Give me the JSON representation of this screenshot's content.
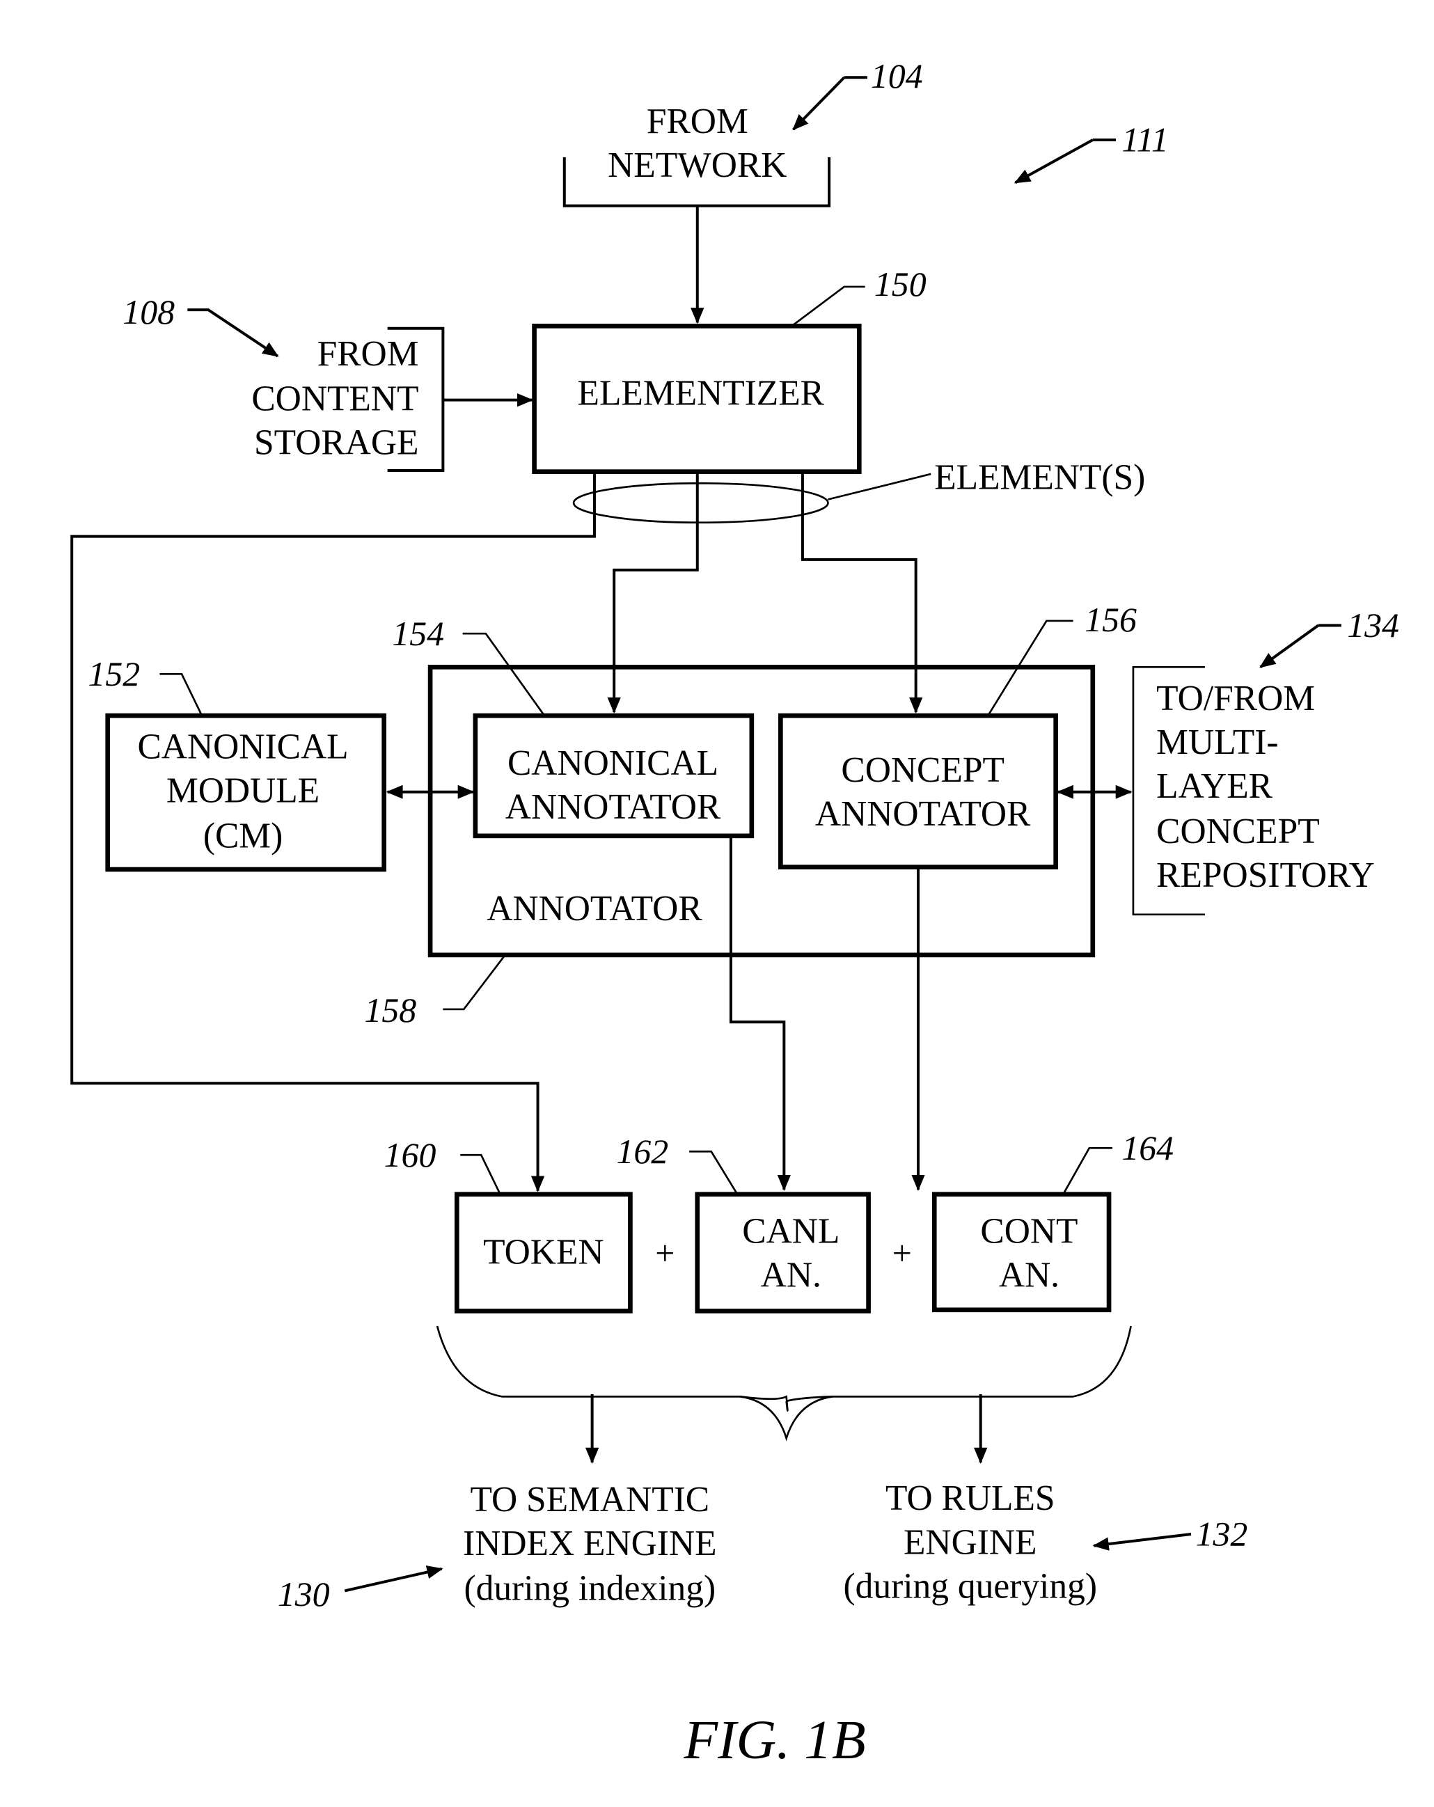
{
  "figure": {
    "caption": "FIG. 1B",
    "overall_ref": "111"
  },
  "inputs": {
    "network": {
      "ref": "104",
      "lines": [
        "FROM",
        "NETWORK"
      ]
    },
    "content_storage": {
      "ref": "108",
      "lines": [
        "FROM",
        "CONTENT",
        "STORAGE"
      ]
    }
  },
  "elementizer": {
    "ref": "150",
    "label": "ELEMENTIZER"
  },
  "elements_label": "ELEMENT(S)",
  "canonical_module": {
    "ref": "152",
    "lines": [
      "CANONICAL",
      "MODULE",
      "(CM)"
    ]
  },
  "annotator": {
    "ref": "158",
    "label": "ANNOTATOR",
    "canonical_annotator": {
      "ref": "154",
      "lines": [
        "CANONICAL",
        "ANNOTATOR"
      ]
    },
    "concept_annotator": {
      "ref": "156",
      "lines": [
        "CONCEPT",
        "ANNOTATOR"
      ]
    }
  },
  "repository": {
    "ref": "134",
    "lines": [
      "TO/FROM",
      "MULTI-",
      "LAYER",
      "CONCEPT",
      "REPOSITORY"
    ]
  },
  "outputs": {
    "token": {
      "ref": "160",
      "lines": [
        "TOKEN"
      ]
    },
    "canl_an": {
      "ref": "162",
      "lines": [
        "CANL",
        "AN."
      ]
    },
    "cont_an": {
      "ref": "164",
      "lines": [
        "CONT",
        "AN."
      ]
    },
    "plus": "+"
  },
  "destinations": {
    "semantic_index": {
      "ref": "130",
      "lines": [
        "TO SEMANTIC",
        "INDEX ENGINE",
        "(during indexing)"
      ]
    },
    "rules_engine": {
      "ref": "132",
      "lines": [
        "TO RULES",
        "ENGINE",
        "(during querying)"
      ]
    }
  }
}
